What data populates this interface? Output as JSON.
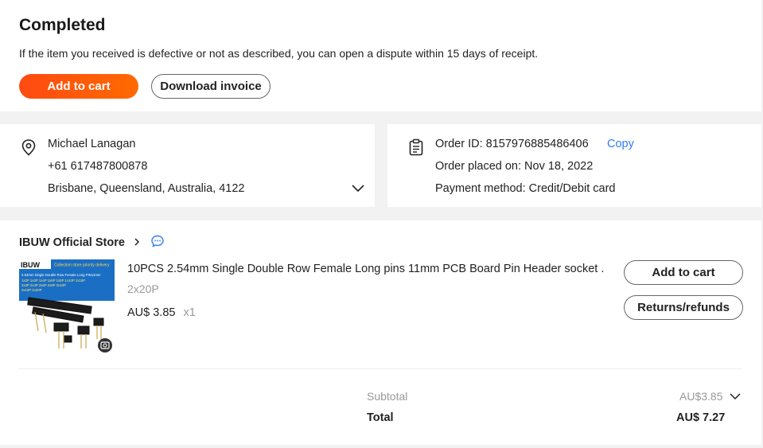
{
  "status": {
    "title": "Completed",
    "description": "If the item you received is defective or not as described, you can open a dispute within 15 days of receipt.",
    "add_to_cart_label": "Add to cart",
    "download_invoice_label": "Download invoice"
  },
  "address": {
    "name": "Michael Lanagan",
    "phone": "+61 617487800878",
    "location": "Brisbane, Queensland, Australia, 4122",
    "icon": "location-pin-icon"
  },
  "order": {
    "id_label": "Order ID: 8157976885486406",
    "copy_label": "Copy",
    "placed_on": "Order placed on: Nov 18, 2022",
    "payment": "Payment method: Credit/Debit card",
    "icon": "clipboard-icon"
  },
  "store": {
    "name": "IBUW Official Store",
    "product": {
      "title": "10PCS 2.54mm Single Double Row Female Long pins 11mm PCB Board Pin Header socket ...",
      "variant": "2x20P",
      "price": "AU$ 3.85",
      "qty": "x1",
      "image_brand": "IBUW",
      "image_banner": "Collection store priority delivery",
      "image_caption": "2.54mm Single Double Row Female Long PIN11mm",
      "image_sizes_1": "1x2P 1x3P 1x4P 1x6P 1x8P 1x10P 1x15P",
      "image_sizes_2": "2x3P 2x4P 2x6P 2x8P 2x10P",
      "image_sizes_3": "2x15P 2x20P"
    },
    "add_to_cart_label": "Add to cart",
    "returns_label": "Returns/refunds",
    "subtotal_label": "Subtotal",
    "subtotal_value": "AU$3.85",
    "total_label": "Total",
    "total_value": "AU$ 7.27"
  },
  "colors": {
    "accent": "#ff5a0a",
    "link": "#2e7cf6",
    "muted": "#999999"
  }
}
